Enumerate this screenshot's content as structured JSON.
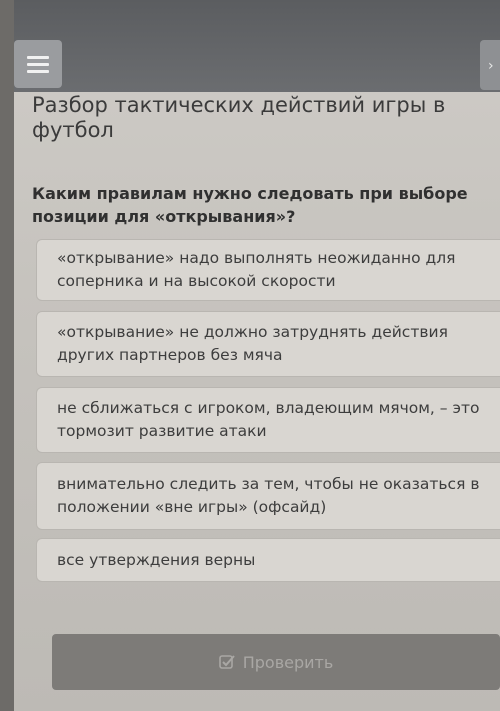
{
  "header": {
    "menu_icon": "hamburger-menu-icon",
    "title": "Разбор тактических действий игры в футбол"
  },
  "question": {
    "text": "Каким правилам нужно следовать при выборе позиции для «открывания»?"
  },
  "options": [
    {
      "label": "«открывание» надо выполнять неожиданно для соперника и на высокой скорости"
    },
    {
      "label": "«открывание» не должно затруднять действия других партнеров без мяча"
    },
    {
      "label": "не сближаться с игроком, владеющим мячом, – это тормозит развитие атаки"
    },
    {
      "label": "внимательно следить за тем, чтобы не оказаться в положении «вне игры» (офсайд)"
    },
    {
      "label": "все утверждения верны"
    }
  ],
  "footer": {
    "check_label": "Проверить",
    "check_icon": "checkbox-check-icon"
  }
}
